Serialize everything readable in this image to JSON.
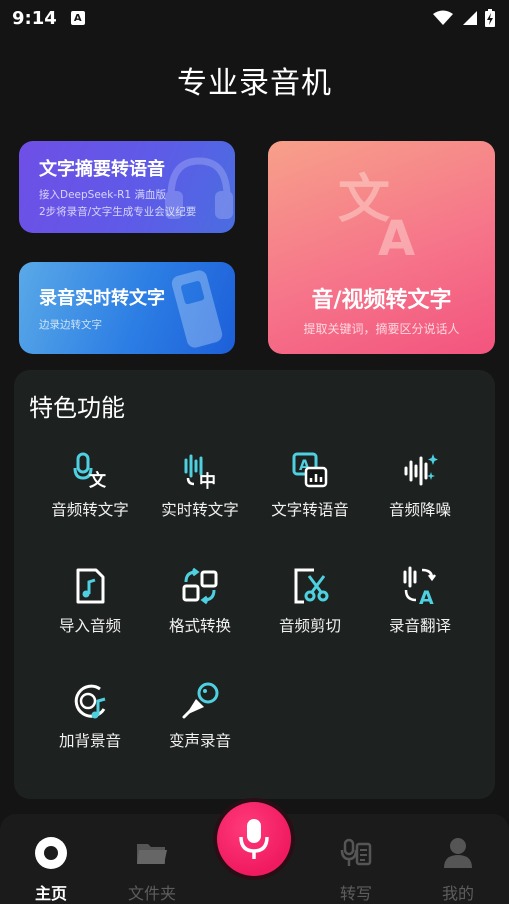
{
  "status_bar": {
    "time": "9:14",
    "notification_glyph": "A",
    "icons": [
      "wifi-icon",
      "signal-icon",
      "battery-charging-icon"
    ]
  },
  "app": {
    "title": "专业录音机"
  },
  "cards": {
    "summary": {
      "title": "文字摘要转语音",
      "subtitle_line1": "接入DeepSeek-R1 满血版",
      "subtitle_line2": "2步将录音/文字生成专业会议纪要",
      "icon": "headphones-icon"
    },
    "realtime": {
      "title": "录音实时转文字",
      "subtitle": "边录边转文字",
      "icon": "recorder-icon"
    },
    "audio_video": {
      "title": "音/视频转文字",
      "subtitle": "提取关键词，摘要区分说话人",
      "icon": "translate-icon"
    }
  },
  "features": {
    "title": "特色功能",
    "items": [
      {
        "label": "音频转文字",
        "icon": "audio-to-text-icon"
      },
      {
        "label": "实时转文字",
        "icon": "realtime-text-icon"
      },
      {
        "label": "文字转语音",
        "icon": "text-to-speech-icon"
      },
      {
        "label": "音频降噪",
        "icon": "noise-reduction-icon"
      },
      {
        "label": "导入音频",
        "icon": "import-audio-icon"
      },
      {
        "label": "格式转换",
        "icon": "format-convert-icon"
      },
      {
        "label": "音频剪切",
        "icon": "audio-cut-icon"
      },
      {
        "label": "录音翻译",
        "icon": "recording-translate-icon"
      },
      {
        "label": "加背景音",
        "icon": "background-music-icon"
      },
      {
        "label": "变声录音",
        "icon": "voice-changer-icon"
      }
    ]
  },
  "tabs": [
    {
      "label": "主页",
      "icon": "home-icon",
      "active": true
    },
    {
      "label": "文件夹",
      "icon": "folder-icon",
      "active": false
    },
    {
      "label": "转写",
      "icon": "transcribe-icon",
      "active": false
    },
    {
      "label": "我的",
      "icon": "profile-icon",
      "active": false
    }
  ],
  "record_button": {
    "icon": "microphone-icon"
  },
  "colors": {
    "accent": "#f01a61",
    "feature_icon": "#4fd0e0",
    "background": "#141414"
  }
}
